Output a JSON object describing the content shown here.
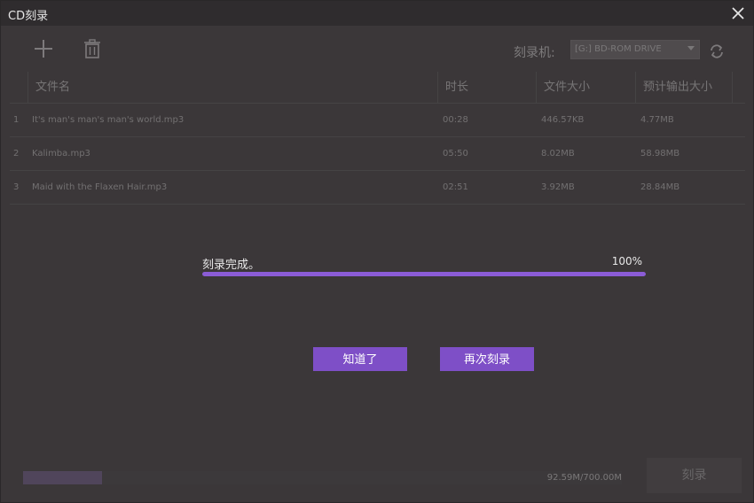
{
  "window": {
    "title": "CD刻录"
  },
  "toolbar": {
    "burner_label": "刻录机:",
    "burner_value": "[G:] BD-ROM DRIVE  ",
    "icons": [
      "add-icon",
      "trash-icon",
      "refresh-icon"
    ]
  },
  "table": {
    "headers": {
      "name": "文件名",
      "duration": "时长",
      "size": "文件大小",
      "output": "预计输出大小"
    },
    "rows": [
      {
        "index": "1",
        "name": "It's man's man's man's world.mp3",
        "duration": "00:28",
        "size": "446.57KB",
        "output": "4.77MB"
      },
      {
        "index": "2",
        "name": "Kalimba.mp3",
        "duration": "05:50",
        "size": "8.02MB",
        "output": "58.98MB"
      },
      {
        "index": "3",
        "name": "Maid with the Flaxen Hair.mp3",
        "duration": "02:51",
        "size": "3.92MB",
        "output": "28.84MB"
      }
    ]
  },
  "progress": {
    "status": "刻录完成。",
    "percent_label": "100%",
    "value": 1.0
  },
  "buttons": {
    "ok": "知道了",
    "again": "再次刻录",
    "burn": "刻录"
  },
  "capacity": {
    "label": "92.59M/700.00M",
    "used_fraction": 0.132
  },
  "colors": {
    "accent": "#7e4fc7",
    "progress_fill": "#8b5cd6",
    "background": "#3b3739"
  }
}
